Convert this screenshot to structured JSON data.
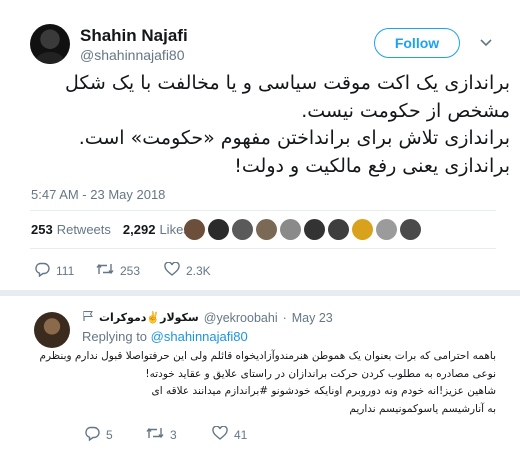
{
  "tweet": {
    "author_name": "Shahin Najafi",
    "author_handle": "@shahinnajafi80",
    "follow_label": "Follow",
    "text_lines": [
      "براندازی یک اکت موقت سیاسی و یا مخالفت با یک شکل",
      "مشخص از حکومت نیست.",
      "براندازی تلاش برای برانداختن مفهوم «حکومت» است.",
      "براندازی یعنی رفع مالکیت و دولت!"
    ],
    "timestamp": "5:47 AM - 23 May 2018",
    "retweets_count": "253",
    "retweets_label": "Retweets",
    "likes_count": "2,292",
    "likes_label": "Likes",
    "liker_avatar_colors": [
      "#6b4f3a",
      "#2b2b2b",
      "#5a5a5a",
      "#7a6a55",
      "#8a8a8a",
      "#333333",
      "#3e3e3e",
      "#d9a21c",
      "#9b9b9b",
      "#4a4a4a"
    ],
    "actions": {
      "reply_count": "111",
      "retweet_count": "253",
      "like_count": "2.3K"
    }
  },
  "reply": {
    "author_name": "سکولار✌️دموکرات",
    "author_handle": "@yekroobahi",
    "separator": "·",
    "date": "May 23",
    "replying_to_label": "Replying to",
    "replying_to_handle": "@shahinnajafi80",
    "text_lines": [
      "باهمه احترامی که برات بعنوان یک هموطن هنرمندوآزادیخواه قائلم ولی این حرفتواصلا قبول ندارم وبنظرم",
      "نوعی مصادره به مطلوب کردن حرکت براندازان  در راستای علایق و عقاید خودته!",
      "شاهین عزیز!انه  خودم ونه دوروبرم اونایکه خودشونو #براندازم میدانند علاقه ای",
      "به آنارشیسم یاسوکمونیسم نداریم"
    ],
    "actions": {
      "reply_count": "5",
      "retweet_count": "3",
      "like_count": "41"
    }
  },
  "colors": {
    "accent": "#1da1f2",
    "muted": "#657786",
    "text": "#14171a",
    "divider": "#e6ecf0"
  },
  "icons": {
    "reply": "reply-icon",
    "retweet": "retweet-icon",
    "like": "heart-icon",
    "caret": "chevron-down-icon",
    "flag": "flag-icon",
    "peace": "peace-hand-icon"
  }
}
